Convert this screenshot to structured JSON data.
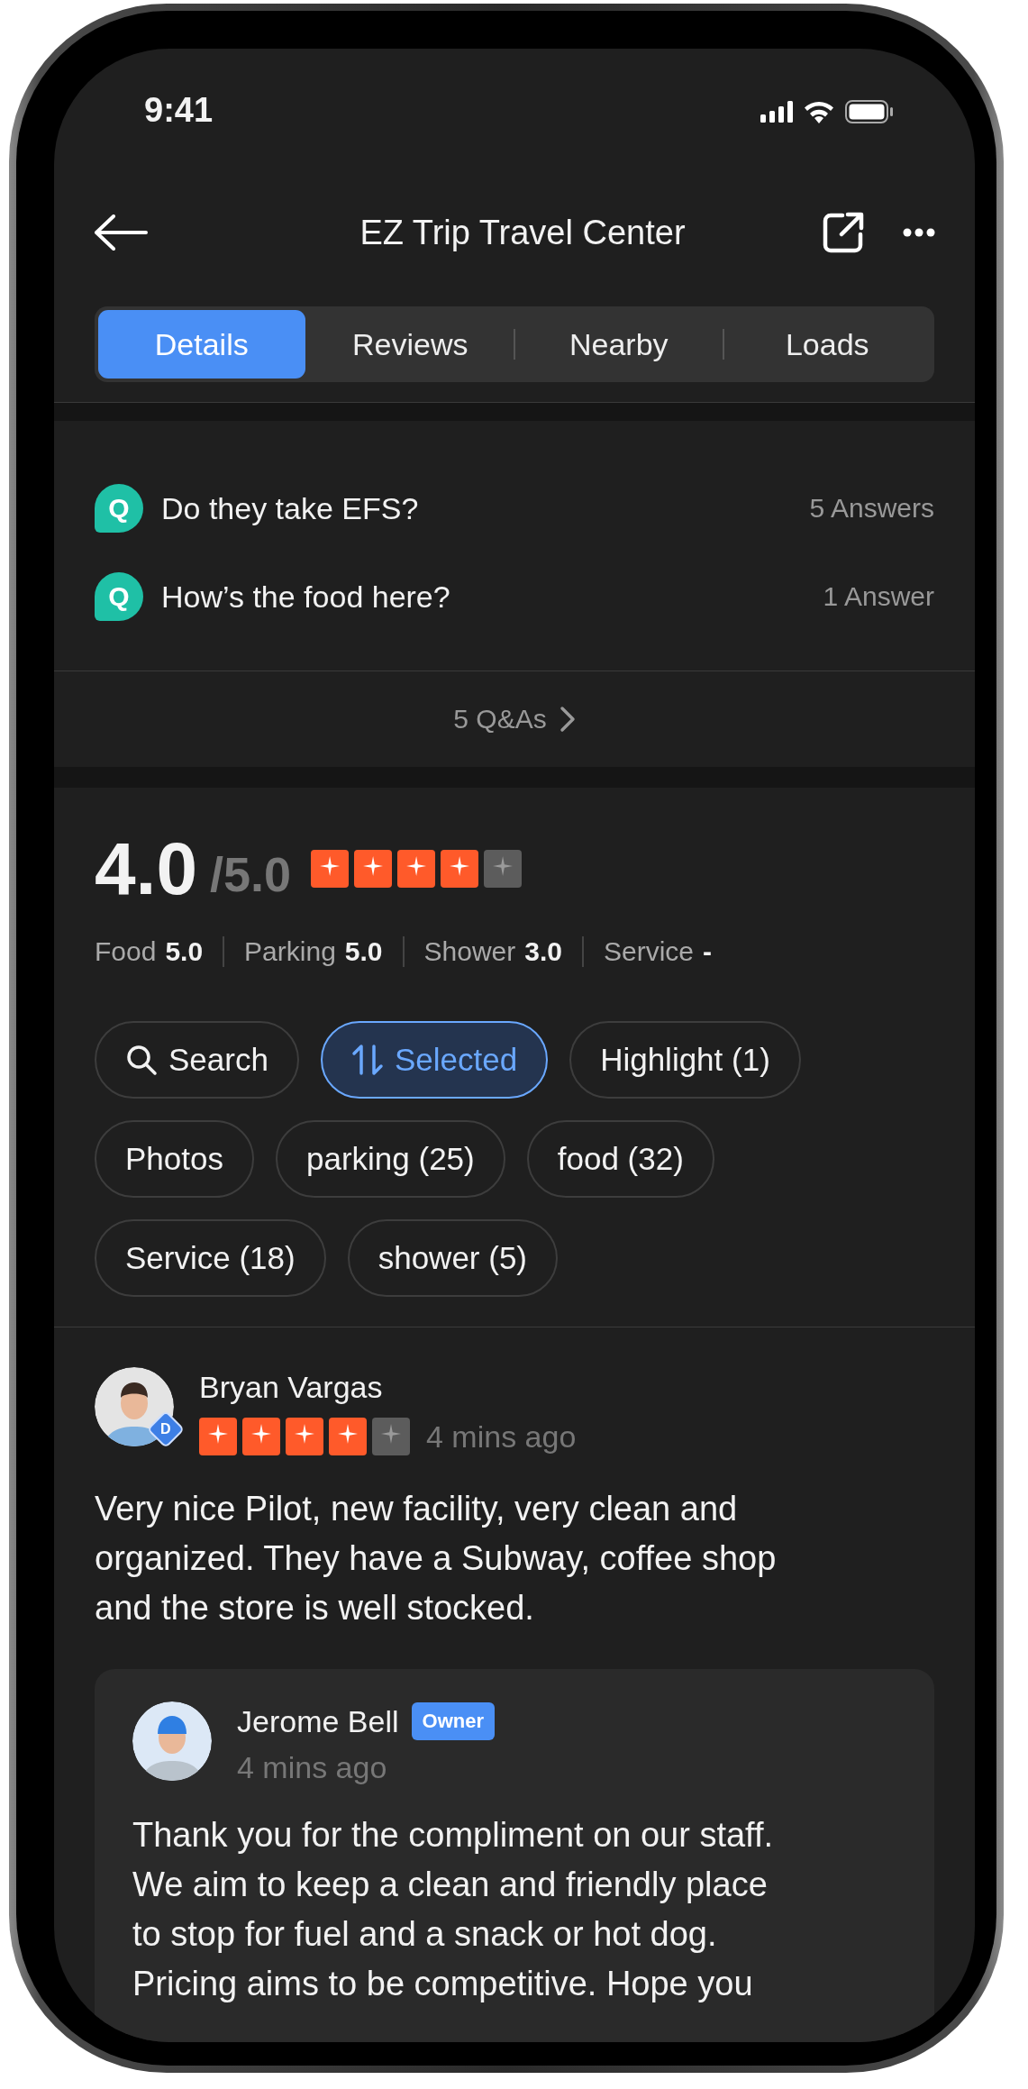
{
  "status_bar": {
    "time": "9:41"
  },
  "header": {
    "title": "EZ Trip Travel Center"
  },
  "tabs": [
    {
      "label": "Details",
      "selected": true
    },
    {
      "label": "Reviews",
      "selected": false
    },
    {
      "label": "Nearby",
      "selected": false
    },
    {
      "label": "Loads",
      "selected": false
    }
  ],
  "questions": [
    {
      "badge": "Q",
      "text": "Do they take EFS?",
      "answers": "5 Answers"
    },
    {
      "badge": "Q",
      "text": "How’s the food here?",
      "answers": "1 Answer"
    }
  ],
  "qa_link": "5 Q&As",
  "rating": {
    "score": "4.0",
    "out_of": "/5.0",
    "stars": 4,
    "categories": [
      {
        "label": "Food",
        "value": "5.0"
      },
      {
        "label": "Parking",
        "value": "5.0"
      },
      {
        "label": "Shower",
        "value": "3.0"
      },
      {
        "label": "Service",
        "value": "-"
      }
    ]
  },
  "filters": [
    {
      "kind": "search",
      "label": "Search",
      "selected": false
    },
    {
      "kind": "sort",
      "label": "Selected",
      "selected": true
    },
    {
      "kind": "tag",
      "label": "Highlight (1)",
      "selected": false
    },
    {
      "kind": "tag",
      "label": "Photos",
      "selected": false
    },
    {
      "kind": "tag",
      "label": "parking (25)",
      "selected": false
    },
    {
      "kind": "tag",
      "label": "food (32)",
      "selected": false
    },
    {
      "kind": "tag",
      "label": "Service (18)",
      "selected": false
    },
    {
      "kind": "tag",
      "label": "shower (5)",
      "selected": false
    }
  ],
  "review": {
    "author": "Bryan Vargas",
    "badge": "D",
    "stars": 4,
    "time": "4 mins ago",
    "text": "Very nice Pilot, new facility, very clean and organized. They have a Subway, coffee shop and the store is well stocked.",
    "reply": {
      "author": "Jerome Bell",
      "role": "Owner",
      "time": "4 mins ago",
      "text": "Thank you for the compliment on our staff. We aim to keep a clean and friendly place to stop for fuel and a snack or hot dog. Pricing aims to be competitive. Hope you"
    }
  }
}
